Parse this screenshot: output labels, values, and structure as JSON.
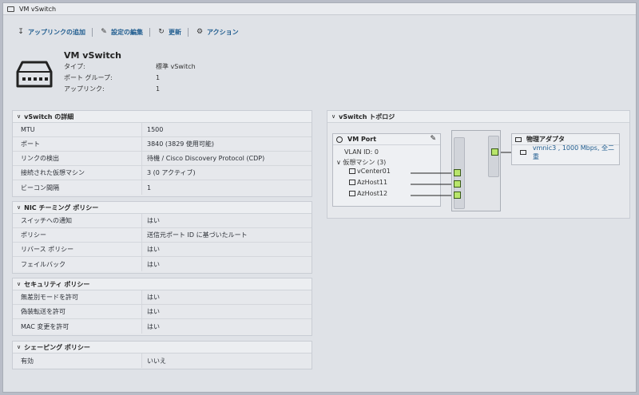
{
  "window": {
    "title": "VM vSwitch"
  },
  "toolbar": {
    "add_uplink": "アップリンクの追加",
    "edit_settings": "設定の編集",
    "refresh": "更新",
    "actions": "アクション"
  },
  "header": {
    "title": "VM vSwitch",
    "rows": [
      {
        "label": "タイプ:",
        "value": "標準 vSwitch"
      },
      {
        "label": "ポート グループ:",
        "value": "1"
      },
      {
        "label": "アップリンク:",
        "value": "1"
      }
    ]
  },
  "details": {
    "title": "vSwitch の詳細",
    "rows": [
      {
        "label": "MTU",
        "value": "1500"
      },
      {
        "label": "ポート",
        "value": "3840 (3829 使用可能)"
      },
      {
        "label": "リンクの検出",
        "value": "待機 / Cisco Discovery Protocol (CDP)"
      },
      {
        "label": "接続された仮想マシン",
        "value": "3 (0 アクティブ)"
      },
      {
        "label": "ビーコン間隔",
        "value": "1"
      }
    ]
  },
  "teaming": {
    "title": "NIC チーミング ポリシー",
    "rows": [
      {
        "label": "スイッチへの通知",
        "value": "はい"
      },
      {
        "label": "ポリシー",
        "value": "送信元ポート ID に基づいたルート"
      },
      {
        "label": "リバース ポリシー",
        "value": "はい"
      },
      {
        "label": "フェイルバック",
        "value": "はい"
      }
    ]
  },
  "security": {
    "title": "セキュリティ ポリシー",
    "rows": [
      {
        "label": "無差別モードを許可",
        "value": "はい"
      },
      {
        "label": "偽装転送を許可",
        "value": "はい"
      },
      {
        "label": "MAC 変更を許可",
        "value": "はい"
      }
    ]
  },
  "shaping": {
    "title": "シェーピング ポリシー",
    "rows": [
      {
        "label": "有効",
        "value": "いいえ"
      }
    ]
  },
  "topology": {
    "title": "vSwitch トポロジ",
    "port_group": {
      "name": "VM Port",
      "vlan": "VLAN ID: 0",
      "vm_group": "仮想マシン (3)",
      "vms": [
        "vCenter01",
        "AzHost11",
        "AzHost12"
      ]
    },
    "physical_adapters": {
      "title": "物理アダプタ",
      "nics": [
        "vmnic3 , 1000 Mbps, 全二重"
      ]
    }
  },
  "colors": {
    "link": "#1f5c8f",
    "port": "#b9e66c"
  }
}
